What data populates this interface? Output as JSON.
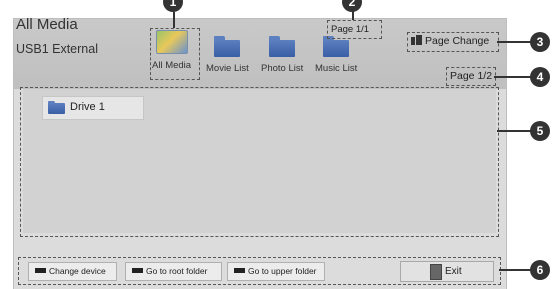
{
  "app": {
    "title": "All Media",
    "device": "USB1 External"
  },
  "mode_tabs": [
    {
      "label": "All Media",
      "icon": "all-media-icon"
    },
    {
      "label": "Movie List",
      "icon": "folder-icon"
    },
    {
      "label": "Photo List",
      "icon": "folder-icon"
    },
    {
      "label": "Music List",
      "icon": "folder-icon"
    }
  ],
  "header": {
    "tab_page": "Page 1/1",
    "page_change": "Page Change",
    "list_page": "Page 1/2"
  },
  "content": {
    "items": [
      {
        "label": "Drive 1",
        "icon": "folder-icon"
      }
    ]
  },
  "footer": {
    "buttons": [
      {
        "label": "Change device",
        "swatch_color": "#222222"
      },
      {
        "label": "Go to root folder",
        "swatch_color": "#222222"
      },
      {
        "label": "Go to upper folder",
        "swatch_color": "#222222"
      }
    ],
    "exit_label": "Exit"
  },
  "callouts": [
    "1",
    "2",
    "3",
    "4",
    "5",
    "6"
  ],
  "colors": {
    "panel": "#dcdcdc",
    "folder": "#4a6fb3",
    "callout": "#333333"
  }
}
